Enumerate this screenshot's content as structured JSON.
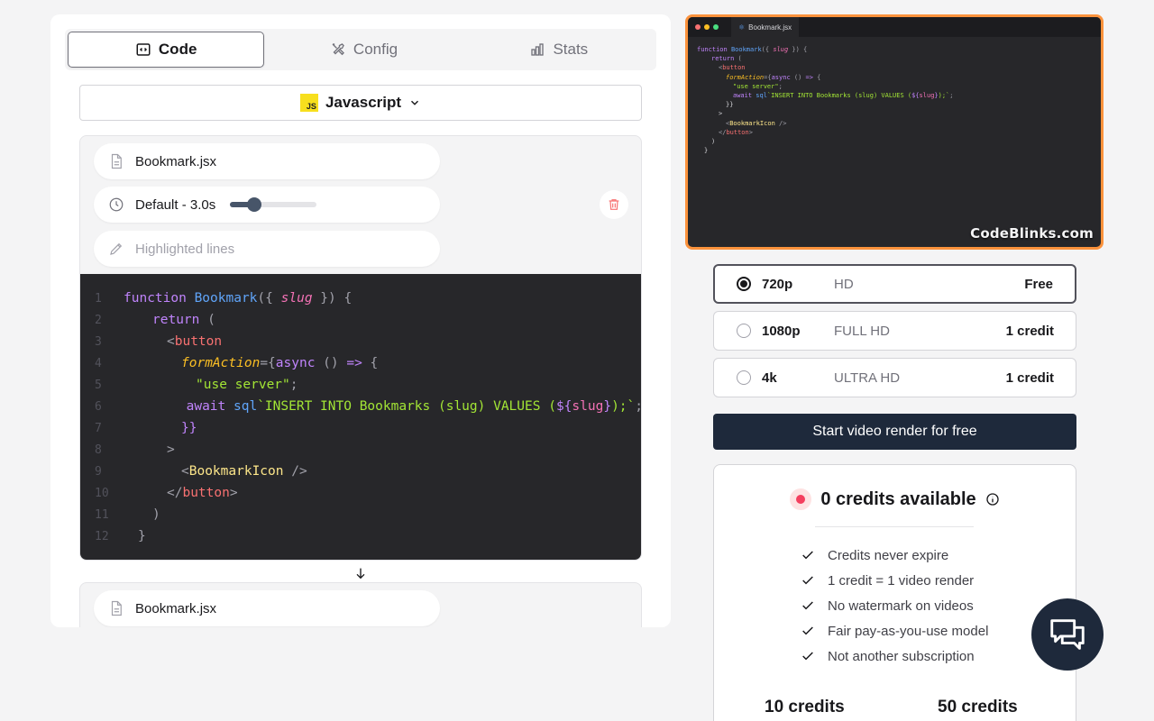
{
  "tabs": [
    {
      "label": "Code",
      "icon": "code-icon",
      "active": true
    },
    {
      "label": "Config",
      "icon": "tools-icon",
      "active": false
    },
    {
      "label": "Stats",
      "icon": "chart-bar-icon",
      "active": false
    }
  ],
  "language": {
    "label": "Javascript",
    "icon": "js-logo",
    "badge": "JS"
  },
  "clip": {
    "filename": "Bookmark.jsx",
    "duration_label": "Default - 3.0s",
    "duration_fraction": 0.2,
    "highlight_placeholder": "Highlighted lines"
  },
  "code_lines": [
    {
      "num": "1"
    },
    {
      "num": "2"
    },
    {
      "num": "3"
    },
    {
      "num": "4"
    },
    {
      "num": "5"
    },
    {
      "num": "6"
    },
    {
      "num": "7"
    },
    {
      "num": "8"
    },
    {
      "num": "9"
    },
    {
      "num": "10"
    },
    {
      "num": "11"
    },
    {
      "num": "12"
    }
  ],
  "code_tokens": {
    "l1": [
      "function",
      "Bookmark",
      "({ ",
      "slug",
      " }) {"
    ],
    "l2": [
      "return",
      " ("
    ],
    "l3": [
      "<",
      "button"
    ],
    "l4": [
      "formAction",
      "={",
      "async",
      " () ",
      "=>",
      " {"
    ],
    "l5": [
      "\"use server\"",
      ";"
    ],
    "l6": [
      "await",
      "sql",
      "`INSERT INTO Bookmarks (slug) VALUES (",
      "${",
      "slug",
      "}",
      ");`",
      ";"
    ],
    "l7": [
      "}}"
    ],
    "l8": [
      ">"
    ],
    "l9": [
      "<",
      "BookmarkIcon",
      " />"
    ],
    "l10": [
      "</",
      "button",
      ">"
    ],
    "l11": [
      ")"
    ],
    "l12": [
      "}"
    ]
  },
  "next_clip": {
    "filename": "Bookmark.jsx"
  },
  "preview": {
    "tab_label": "Bookmark.jsx",
    "watermark": "CodeBlinks.com",
    "border_color": "#fb923c"
  },
  "resolutions": [
    {
      "name": "720p",
      "desc": "HD",
      "price": "Free",
      "selected": true
    },
    {
      "name": "1080p",
      "desc": "FULL HD",
      "price": "1 credit",
      "selected": false
    },
    {
      "name": "4k",
      "desc": "ULTRA HD",
      "price": "1 credit",
      "selected": false
    }
  ],
  "render_button": "Start video render for free",
  "credits": {
    "title": "0 credits available",
    "features": [
      "Credits never expire",
      "1 credit = 1 video render",
      "No watermark on videos",
      "Fair pay-as-you-use model",
      "Not another subscription"
    ],
    "packs": [
      "10 credits",
      "50 credits"
    ]
  },
  "colors": {
    "accent": "#1e293b",
    "code_bg": "#27272a",
    "status_dot": "#f43f5e"
  }
}
